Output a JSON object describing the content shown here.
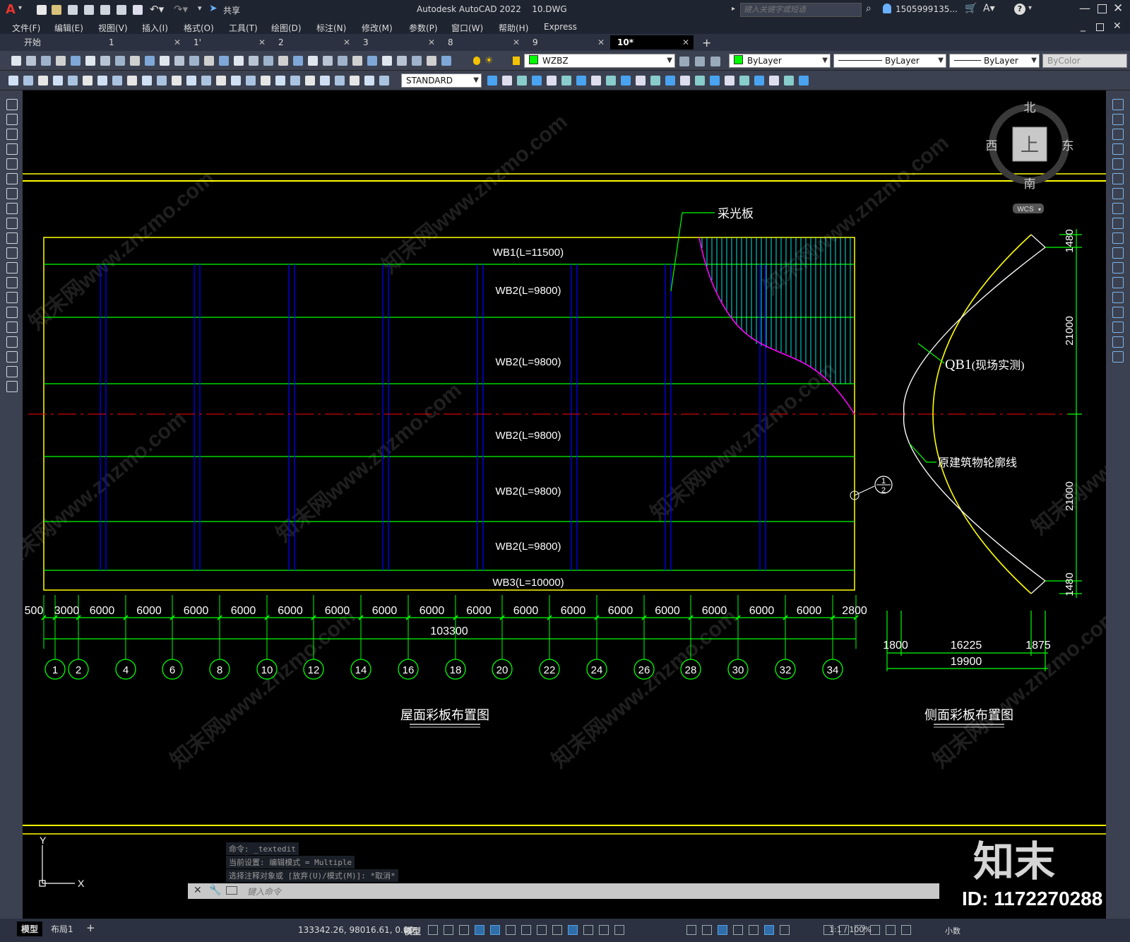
{
  "app": {
    "title": "Autodesk AutoCAD 2022",
    "filename": "10.DWG",
    "logo": "A",
    "share_label": "共享",
    "search_placeholder": "键入关键字或短语",
    "user": "1505999135...",
    "window_controls": [
      "minimize-icon",
      "maximize-icon",
      "close-icon"
    ]
  },
  "menu": [
    "文件(F)",
    "编辑(E)",
    "视图(V)",
    "插入(I)",
    "格式(O)",
    "工具(T)",
    "绘图(D)",
    "标注(N)",
    "修改(M)",
    "参数(P)",
    "窗口(W)",
    "帮助(H)",
    "Express"
  ],
  "tabs": [
    {
      "label": "开始",
      "active": false
    },
    {
      "label": "1",
      "active": false
    },
    {
      "label": "1'",
      "active": false
    },
    {
      "label": "2",
      "active": false
    },
    {
      "label": "3",
      "active": false
    },
    {
      "label": "8",
      "active": false
    },
    {
      "label": "9",
      "active": false
    },
    {
      "label": "10*",
      "active": true
    }
  ],
  "toolbar": {
    "layer": "WZBZ",
    "color": "ByLayer",
    "linetype": "ByLayer",
    "lineweight": "ByLayer",
    "plotstyle": "ByColor",
    "textstyle": "STANDARD"
  },
  "viewcube": {
    "north": "北",
    "south": "南",
    "east": "东",
    "west": "西",
    "face": "上",
    "wcs": "WCS"
  },
  "drawing": {
    "roof_title": "屋面彩板布置图",
    "side_title": "侧面彩板布置图",
    "skylight_label": "采光板",
    "panels": [
      "WB1(L=11500)",
      "WB2(L=9800)",
      "WB2(L=9800)",
      "WB2(L=9800)",
      "WB2(L=9800)",
      "WB2(L=9800)",
      "WB3(L=10000)"
    ],
    "dims_bottom": [
      "500",
      "3000",
      "6000",
      "6000",
      "6000",
      "6000",
      "6000",
      "6000",
      "6000",
      "6000",
      "6000",
      "6000",
      "6000",
      "6000",
      "6000",
      "6000",
      "6000",
      "6000",
      "2800"
    ],
    "total_dim": "103300",
    "axes": [
      "1",
      "2",
      "4",
      "6",
      "8",
      "10",
      "12",
      "14",
      "16",
      "18",
      "20",
      "22",
      "24",
      "26",
      "28",
      "30",
      "32",
      "34"
    ],
    "qb_label": "QB1",
    "qb_note": "(现场实测)",
    "outline_label": "原建筑物轮廓线",
    "section_top": "1",
    "section_bottom": "2",
    "side_dims_vertical": [
      "1480",
      "21000",
      "21000",
      "1480"
    ],
    "side_dims_horizontal": [
      "1800",
      "16225",
      "1875"
    ],
    "side_total": "19900"
  },
  "command": {
    "history": [
      "命令: _textedit",
      "当前设置: 编辑模式 = Multiple",
      "选择注释对象或 [放弃(U)/模式(M)]: *取消*"
    ],
    "prompt_placeholder": "键入命令"
  },
  "status": {
    "model_tab": "模型",
    "layout_tab": "布局1",
    "add_tab": "+",
    "coords": "133342.26, 98016.61, 0.00",
    "model_label": "模型",
    "scale": "1:1 / 100%",
    "units": "小数"
  },
  "watermark": {
    "logo": "知末",
    "id": "ID: 1172270288",
    "text": "知末网www.znzmo.com"
  }
}
